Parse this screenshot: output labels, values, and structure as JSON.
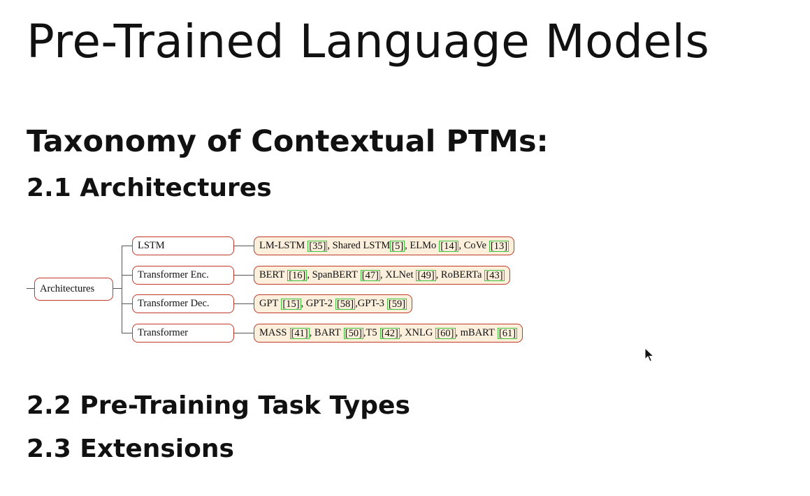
{
  "slide": {
    "title": "Pre-Trained Language Models",
    "subtitle": "Taxonomy of Contextual PTMs:",
    "sections": [
      "2.1 Architectures",
      "2.2 Pre-Training Task Types",
      "2.3 Extensions"
    ]
  },
  "taxonomy": {
    "root": "Architectures",
    "branches": [
      {
        "label": "LSTM",
        "models": [
          {
            "name": "LM-LSTM",
            "ref": "[35]",
            "sep": ", "
          },
          {
            "name": "Shared LSTM",
            "ref": "[5]",
            "sep": ", ",
            "tight": true
          },
          {
            "name": "ELMo",
            "ref": "[14]",
            "sep": ", "
          },
          {
            "name": "CoVe",
            "ref": "[13]",
            "sep": ""
          }
        ]
      },
      {
        "label": "Transformer Enc.",
        "models": [
          {
            "name": "BERT",
            "ref": "[16]",
            "sep": ", "
          },
          {
            "name": "SpanBERT",
            "ref": "[47]",
            "sep": ", "
          },
          {
            "name": "XLNet",
            "ref": "[49]",
            "sep": ", "
          },
          {
            "name": "RoBERTa",
            "ref": "[43]",
            "sep": ""
          }
        ]
      },
      {
        "label": "Transformer Dec.",
        "models": [
          {
            "name": "GPT",
            "ref": "[15]",
            "sep": ", "
          },
          {
            "name": "GPT-2",
            "ref": "[58]",
            "sep": ","
          },
          {
            "name": "GPT-3",
            "ref": "[59]",
            "sep": ""
          }
        ]
      },
      {
        "label": "Transformer",
        "models": [
          {
            "name": "MASS",
            "ref": "[41]",
            "sep": ", "
          },
          {
            "name": "BART",
            "ref": "[50]",
            "sep": ","
          },
          {
            "name": "T5",
            "ref": "[42]",
            "sep": ", "
          },
          {
            "name": "XNLG",
            "ref": "[60]",
            "sep": ", "
          },
          {
            "name": "mBART",
            "ref": "[61]",
            "sep": ""
          }
        ]
      }
    ]
  },
  "colors": {
    "node_border": "#c0392b",
    "leaf_fill": "#fcefdc",
    "citation_border": "#3ec23e"
  }
}
